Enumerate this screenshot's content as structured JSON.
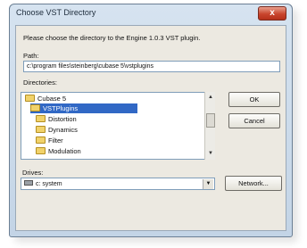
{
  "window": {
    "title": "Choose VST Directory",
    "close_glyph": "x"
  },
  "prompt": "Please choose the directory to the Engine 1.0.3 VST plugin.",
  "path": {
    "label": "Path:",
    "value": "c:\\program files\\steinberg\\cubase 5\\vstplugins"
  },
  "directories": {
    "label": "Directories:",
    "items": [
      {
        "name": "Cubase 5",
        "selected": false
      },
      {
        "name": "VSTPlugins",
        "selected": true
      },
      {
        "name": "Distortion",
        "selected": false
      },
      {
        "name": "Dynamics",
        "selected": false
      },
      {
        "name": "Filter",
        "selected": false
      },
      {
        "name": "Modulation",
        "selected": false
      }
    ]
  },
  "buttons": {
    "ok": "OK",
    "cancel": "Cancel",
    "network": "Network..."
  },
  "drives": {
    "label": "Drives:",
    "selected": "c: system"
  },
  "icons": {
    "folder": "folder-icon",
    "drive": "drive-icon",
    "close": "close-icon"
  }
}
